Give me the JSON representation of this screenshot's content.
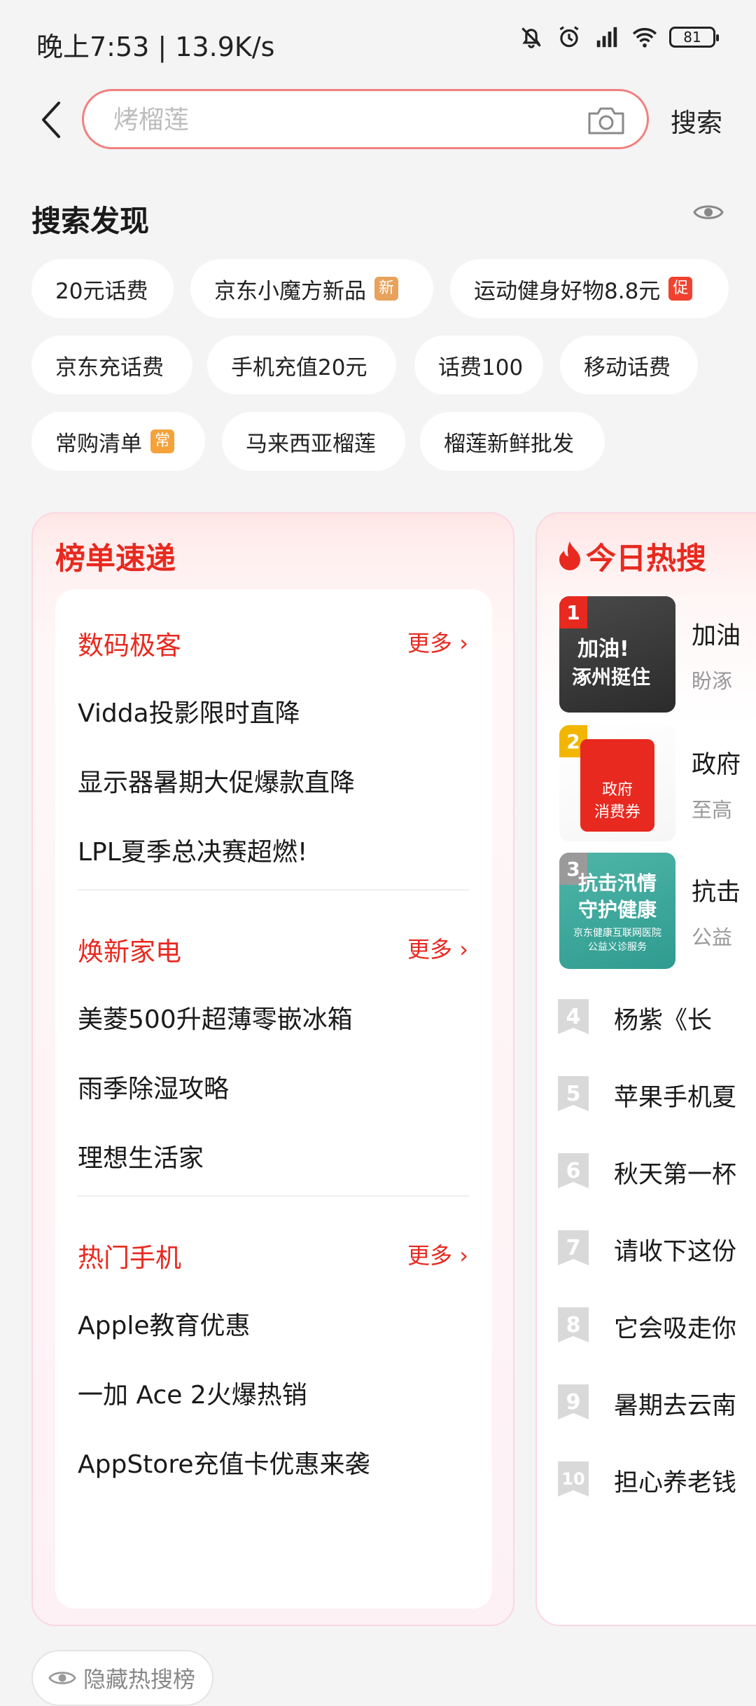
{
  "status_bar": {
    "time": "晚上7:53 | 13.9K/s",
    "battery": "81"
  },
  "header": {
    "search_placeholder": "烤榴莲",
    "search_button": "搜索"
  },
  "discovery": {
    "title": "搜索发现",
    "chips": [
      {
        "label": "20元话费"
      },
      {
        "label": "京东小魔方新品",
        "tag": "新",
        "tag_color": "#e8a25c"
      },
      {
        "label": "运动健身好物8.8元",
        "tag": "促",
        "tag_color": "#f0422f"
      },
      {
        "label": "京东充话费"
      },
      {
        "label": "手机充值20元"
      },
      {
        "label": "话费100"
      },
      {
        "label": "移动话费"
      },
      {
        "label": "常购清单",
        "tag": "常",
        "tag_color": "#f5a23a"
      },
      {
        "label": "马来西亚榴莲"
      },
      {
        "label": "榴莲新鲜批发"
      }
    ]
  },
  "ranking_card": {
    "title": "榜单速递",
    "sections": [
      {
        "title": "数码极客",
        "more": "更多",
        "items": [
          "Vidda投影限时直降",
          "显示器暑期大促爆款直降",
          "LPL夏季总决赛超燃!"
        ]
      },
      {
        "title": "焕新家电",
        "more": "更多",
        "items": [
          "美菱500升超薄零嵌冰箱",
          "雨季除湿攻略",
          "理想生活家"
        ]
      },
      {
        "title": "热门手机",
        "more": "更多",
        "items": [
          "Apple教育优惠",
          "一加 Ace 2火爆热销",
          "AppStore充值卡优惠来袭"
        ]
      }
    ]
  },
  "hot_card": {
    "title": "今日热搜",
    "top": [
      {
        "rank": "1",
        "title": "加油",
        "sub": "盼涿",
        "badge_color": "#e8291f",
        "thumb_text_1": "加油!",
        "thumb_text_2": "涿州挺住"
      },
      {
        "rank": "2",
        "title": "政府",
        "sub": "至高",
        "badge_color": "#f2b600",
        "thumb_text_1": "政府",
        "thumb_text_2": "消费券"
      },
      {
        "rank": "3",
        "title": "抗击",
        "sub": "公益",
        "badge_color": "#9a9a9a",
        "thumb_text_1": "抗击汛情",
        "thumb_text_2": "守护健康",
        "thumb_text_3": "京东健康互联网医院",
        "thumb_text_4": "公益义诊服务"
      }
    ],
    "list": [
      {
        "rank": "4",
        "title": "杨紫《长"
      },
      {
        "rank": "5",
        "title": "苹果手机夏"
      },
      {
        "rank": "6",
        "title": "秋天第一杯"
      },
      {
        "rank": "7",
        "title": "请收下这份"
      },
      {
        "rank": "8",
        "title": "它会吸走你"
      },
      {
        "rank": "9",
        "title": "暑期去云南"
      },
      {
        "rank": "10",
        "title": "担心养老钱"
      }
    ]
  },
  "hide_button": {
    "label": "隐藏热搜榜"
  }
}
